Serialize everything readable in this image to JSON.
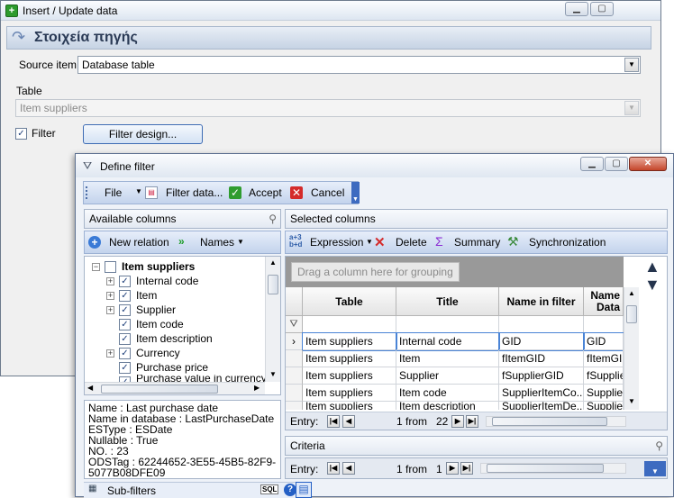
{
  "outer": {
    "title": "Insert / Update data",
    "section_title": "Στοιχεία πηγής",
    "source_item_label": "Source item",
    "source_item_value": "Database table",
    "table_label": "Table",
    "table_value": "Item suppliers",
    "filter_checkbox_label": "Filter",
    "filter_checked": "✓",
    "filter_design_button": "Filter design..."
  },
  "filter_dialog": {
    "title": "Define filter",
    "toolbar": {
      "file": "File",
      "filter_data": "Filter data...",
      "accept": "Accept",
      "cancel": "Cancel"
    },
    "available_columns": {
      "header": "Available columns",
      "new_relation": "New relation",
      "names": "Names",
      "tree": [
        {
          "label": "Item suppliers",
          "level": 0,
          "expander": "−",
          "checked": ""
        },
        {
          "label": "Internal code",
          "level": 1,
          "expander": "+",
          "checked": "✓"
        },
        {
          "label": "Item",
          "level": 1,
          "expander": "+",
          "checked": "✓"
        },
        {
          "label": "Supplier",
          "level": 1,
          "expander": "+",
          "checked": "✓"
        },
        {
          "label": "Item code",
          "level": 1,
          "expander": "",
          "checked": "✓"
        },
        {
          "label": "Item description",
          "level": 1,
          "expander": "",
          "checked": "✓"
        },
        {
          "label": "Currency",
          "level": 1,
          "expander": "+",
          "checked": "✓"
        },
        {
          "label": "Purchase price",
          "level": 1,
          "expander": "",
          "checked": "✓"
        },
        {
          "label": "Purchase value in currency",
          "level": 1,
          "expander": "",
          "checked": "✓"
        }
      ],
      "info": [
        "Name : Last purchase date",
        "Name in database : LastPurchaseDate",
        "ESType : ESDate",
        "Nullable : True",
        "NO. : 23",
        "ODSTag : 62244652-3E55-45B5-82F9-",
        "5077B08DFE09"
      ],
      "sub_filters": "Sub-filters"
    },
    "selected_columns": {
      "header": "Selected columns",
      "expression": "Expression",
      "delete": "Delete",
      "summary": "Summary",
      "synchronization": "Synchronization",
      "group_hint": "Drag a column here for grouping",
      "columns": [
        "Table",
        "Title",
        "Name in filter",
        "Name\nData"
      ],
      "rows": [
        [
          "Item suppliers",
          "Internal code",
          "GID",
          "GID"
        ],
        [
          "Item suppliers",
          "Item",
          "fItemGID",
          "fItemGID"
        ],
        [
          "Item suppliers",
          "Supplier",
          "fSupplierGID",
          "fSupplier"
        ],
        [
          "Item suppliers",
          "Item code",
          "SupplierItemCo...",
          "Supplier"
        ],
        [
          "Item suppliers",
          "Item description",
          "SupplierItemDe...",
          "Supplier"
        ]
      ],
      "entry_label": "Entry:",
      "entry_value": "1 from",
      "entry_total": "22"
    },
    "criteria": {
      "header": "Criteria",
      "entry_label": "Entry:",
      "entry_value": "1 from",
      "entry_total": "1"
    }
  }
}
